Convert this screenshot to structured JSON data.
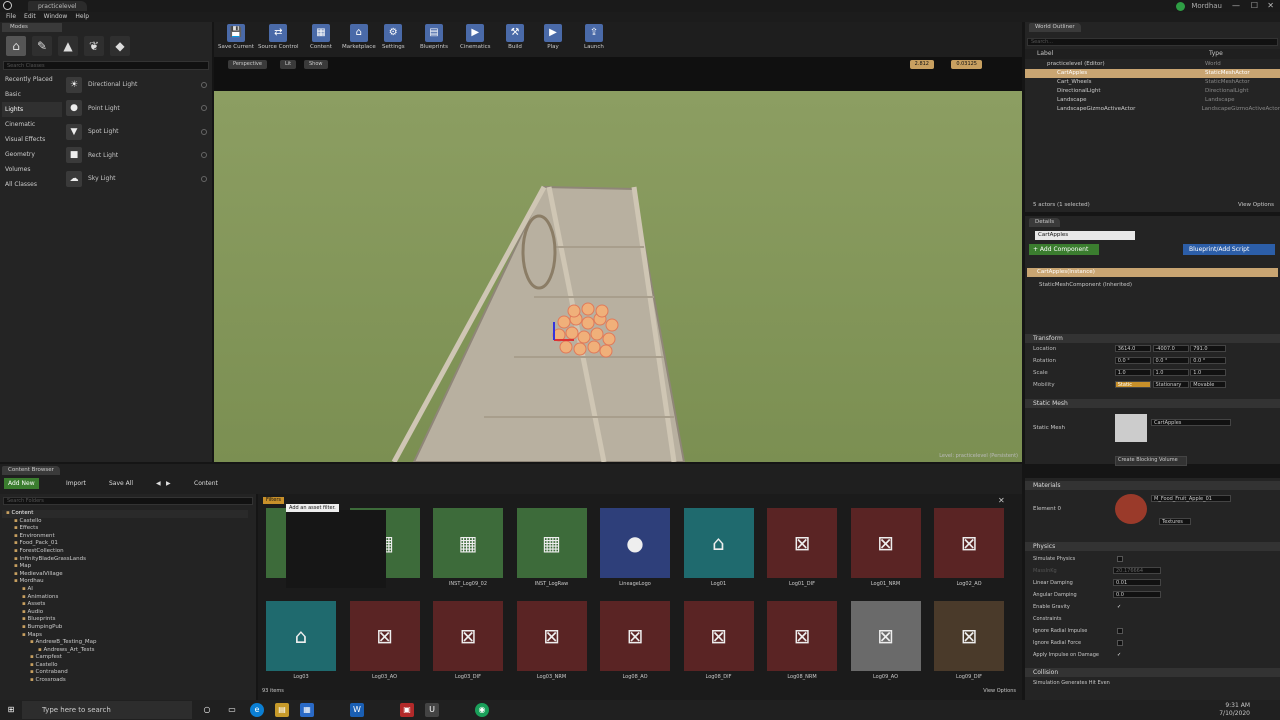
{
  "window": {
    "tab_title": "practicelevel",
    "user": "Mordhau"
  },
  "menu": [
    "File",
    "Edit",
    "Window",
    "Help"
  ],
  "modes": {
    "tab": "Modes",
    "search_placeholder": "Search Classes",
    "categories": [
      {
        "label": "Recently Placed",
        "selected": false
      },
      {
        "label": "Basic",
        "selected": false
      },
      {
        "label": "Lights",
        "selected": true
      },
      {
        "label": "Cinematic",
        "selected": false
      },
      {
        "label": "Visual Effects",
        "selected": false
      },
      {
        "label": "Geometry",
        "selected": false
      },
      {
        "label": "Volumes",
        "selected": false
      },
      {
        "label": "All Classes",
        "selected": false
      }
    ],
    "items": [
      {
        "label": "Directional Light",
        "icon": "directional-light-icon"
      },
      {
        "label": "Point Light",
        "icon": "point-light-icon"
      },
      {
        "label": "Spot Light",
        "icon": "spot-light-icon"
      },
      {
        "label": "Rect Light",
        "icon": "rect-light-icon"
      },
      {
        "label": "Sky Light",
        "icon": "sky-light-icon"
      }
    ]
  },
  "toolbar": [
    {
      "label": "Save Current",
      "icon": "save-icon"
    },
    {
      "label": "Source Control",
      "icon": "source-control-icon"
    },
    {
      "label": "Content",
      "icon": "content-icon"
    },
    {
      "label": "Marketplace",
      "icon": "marketplace-icon"
    },
    {
      "label": "Settings",
      "icon": "settings-icon"
    },
    {
      "label": "Blueprints",
      "icon": "blueprints-icon"
    },
    {
      "label": "Cinematics",
      "icon": "cinematics-icon"
    },
    {
      "label": "Build",
      "icon": "build-icon"
    },
    {
      "label": "Play",
      "icon": "play-icon"
    },
    {
      "label": "Launch",
      "icon": "launch-icon"
    }
  ],
  "viewport": {
    "perspective": "Perspective",
    "lit": "Lit",
    "show": "Show",
    "snap_value": "2.812",
    "scale_value": "0.03125",
    "status": "Level: practicelevel (Persistent)"
  },
  "outliner": {
    "tab": "World Outliner",
    "search_placeholder": "Search...",
    "col_label": "Label",
    "col_type": "Type",
    "rows": [
      {
        "label": "practicelevel (Editor)",
        "type": "World",
        "selected": false,
        "indent": 0
      },
      {
        "label": "CartApples",
        "type": "StaticMeshActor",
        "selected": true,
        "indent": 1
      },
      {
        "label": "Cart_Wheels",
        "type": "StaticMeshActor",
        "selected": false,
        "indent": 1
      },
      {
        "label": "DirectionalLight",
        "type": "DirectionalLight",
        "selected": false,
        "indent": 1
      },
      {
        "label": "Landscape",
        "type": "Landscape",
        "selected": false,
        "indent": 1
      },
      {
        "label": "LandscapeGizmoActiveActor",
        "type": "LandscapeGizmoActiveActor",
        "selected": false,
        "indent": 1
      }
    ],
    "count": "5 actors (1 selected)",
    "view_options": "View Options"
  },
  "details": {
    "tab": "Details",
    "name": "CartApples",
    "add_component": "+ Add Component",
    "blueprint_script": "Blueprint/Add Script",
    "instance": "CartApples(Instance)",
    "component": "StaticMeshComponent (Inherited)",
    "transform": "Transform",
    "location": {
      "label": "Location",
      "x": "3614.0",
      "y": "-4007.0",
      "z": "791.0"
    },
    "rotation": {
      "label": "Rotation",
      "x": "0.0 °",
      "y": "0.0 °",
      "z": "0.0 °"
    },
    "scale": {
      "label": "Scale",
      "x": "1.0",
      "y": "1.0",
      "z": "1.0"
    },
    "mobility": {
      "label": "Mobility",
      "static": "Static",
      "stationary": "Stationary",
      "movable": "Movable"
    },
    "static_mesh_section": "Static Mesh",
    "static_mesh_label": "Static Mesh",
    "static_mesh_value": "CartApples",
    "blocking_volume": "Create Blocking Volume",
    "materials_section": "Materials",
    "element0": "Element 0",
    "material_value": "M_Food_Fruit_Apple_01",
    "textures": "Textures",
    "physics_section": "Physics",
    "simulate": "Simulate Physics",
    "mass": "MassInKg",
    "mass_value": "20.176664",
    "linear": "Linear Damping",
    "linear_value": "0.01",
    "angular": "Angular Damping",
    "angular_value": "0.0",
    "gravity": "Enable Gravity",
    "constraints": "Constraints",
    "radial_impulse": "Ignore Radial Impulse",
    "radial_force": "Ignore Radial Force",
    "apply_impulse": "Apply Impulse on Damage",
    "collision_section": "Collision",
    "sim_hit": "Simulation Generates Hit Even"
  },
  "content_browser": {
    "tab": "Content Browser",
    "add_new": "Add New",
    "import": "Import",
    "save_all": "Save All",
    "path": "Content",
    "folder_search": "Search Folders",
    "filters": "Filters",
    "tooltip": "Add an asset filter.",
    "item_count": "93 items",
    "view_options": "View Options",
    "folders": [
      {
        "label": "Content",
        "indent": 0,
        "sel": true
      },
      {
        "label": "Castello",
        "indent": 1
      },
      {
        "label": "Effects",
        "indent": 1
      },
      {
        "label": "Environment",
        "indent": 1
      },
      {
        "label": "Food_Pack_01",
        "indent": 1
      },
      {
        "label": "ForestCollection",
        "indent": 1
      },
      {
        "label": "InfinityBladeGrassLands",
        "indent": 1
      },
      {
        "label": "Map",
        "indent": 1
      },
      {
        "label": "MedievalVillage",
        "indent": 1
      },
      {
        "label": "Mordhau",
        "indent": 1
      },
      {
        "label": "AI",
        "indent": 2
      },
      {
        "label": "Animations",
        "indent": 2
      },
      {
        "label": "Assets",
        "indent": 2
      },
      {
        "label": "Audio",
        "indent": 2
      },
      {
        "label": "Blueprints",
        "indent": 2
      },
      {
        "label": "BumpingPub",
        "indent": 2
      },
      {
        "label": "Maps",
        "indent": 2
      },
      {
        "label": "AndrewB_Testing_Map",
        "indent": 3
      },
      {
        "label": "Andrews_Art_Tests",
        "indent": 4
      },
      {
        "label": "Campfest",
        "indent": 3
      },
      {
        "label": "Castello",
        "indent": 3
      },
      {
        "label": "Contraband",
        "indent": 3
      },
      {
        "label": "Crossroads",
        "indent": 3
      }
    ],
    "assets_row1": [
      {
        "label": "INST_",
        "color": "#3d6b3a",
        "icon": "box-icon"
      },
      {
        "label": "",
        "color": "#3d6b3a",
        "icon": "box-icon"
      },
      {
        "label": "INST_Log09_02",
        "color": "#3d6b3a",
        "icon": "box-icon"
      },
      {
        "label": "INST_LogRaw",
        "color": "#3d6b3a",
        "icon": "box-icon"
      },
      {
        "label": "LineageLogo",
        "color": "#2e3f7a",
        "icon": "sphere-icon"
      },
      {
        "label": "Log01",
        "color": "#1f6a6e",
        "icon": "mesh-icon"
      },
      {
        "label": "Log01_DIF",
        "color": "#5a2424",
        "icon": "texture-icon"
      },
      {
        "label": "Log01_NRM",
        "color": "#5a2424",
        "icon": "texture-icon"
      },
      {
        "label": "Log02_AO",
        "color": "#5a2424",
        "icon": "texture-icon"
      }
    ],
    "assets_row2": [
      {
        "label": "Log03",
        "color": "#1f6a6e",
        "icon": "mesh-icon"
      },
      {
        "label": "Log03_AO",
        "color": "#5a2424",
        "icon": "texture-icon"
      },
      {
        "label": "Log03_DIF",
        "color": "#5a2424",
        "icon": "texture-icon"
      },
      {
        "label": "Log03_NRM",
        "color": "#5a2424",
        "icon": "texture-icon"
      },
      {
        "label": "Log08_AO",
        "color": "#5a2424",
        "icon": "texture-icon"
      },
      {
        "label": "Log08_DIF",
        "color": "#5a2424",
        "icon": "texture-icon"
      },
      {
        "label": "Log08_NRM",
        "color": "#5a2424",
        "icon": "texture-icon"
      },
      {
        "label": "Log09_AO",
        "color": "#6a6a6a",
        "icon": "texture-icon"
      },
      {
        "label": "Log09_DIF",
        "color": "#4a3a2a",
        "icon": "texture-icon"
      }
    ]
  },
  "taskbar": {
    "search": "Type here to search",
    "time": "9:31 AM",
    "date": "7/10/2020"
  }
}
